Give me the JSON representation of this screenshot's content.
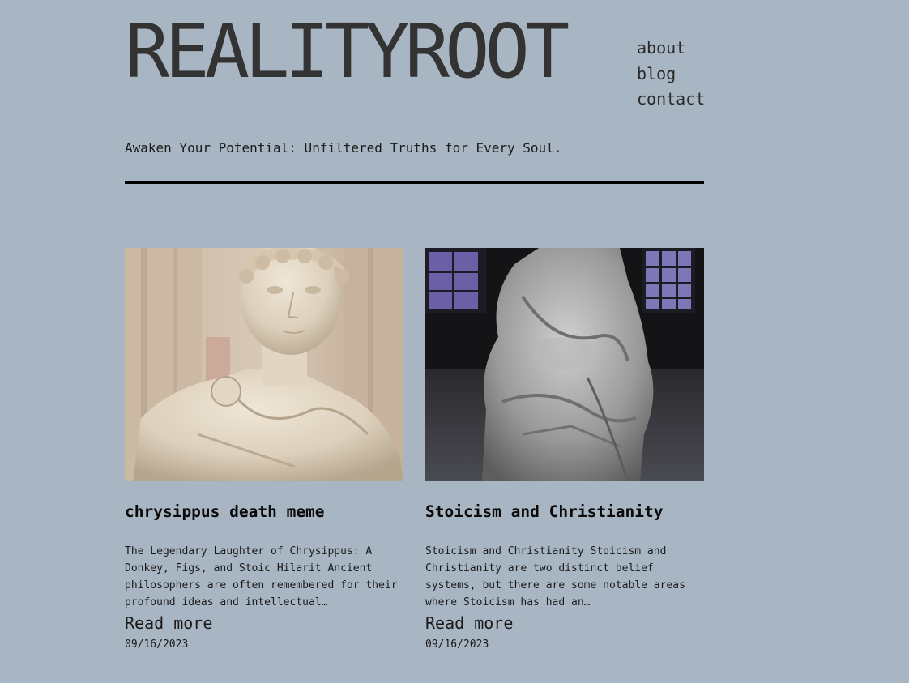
{
  "site": {
    "title": "REALITYROOT",
    "tagline": "Awaken Your Potential: Unfiltered Truths for Every Soul."
  },
  "nav": {
    "items": [
      {
        "label": "about"
      },
      {
        "label": "blog"
      },
      {
        "label": "contact"
      }
    ]
  },
  "posts": [
    {
      "image": "marble-bust-image",
      "title": "chrysippus death meme",
      "excerpt": "The Legendary Laughter of Chrysippus: A Donkey, Figs, and Stoic Hilarit Ancient philosophers are often remembered for their profound ideas and intellectual…",
      "read_more": "Read more",
      "date": "09/16/2023"
    },
    {
      "image": "seated-statue-image",
      "title": "Stoicism and Christianity",
      "excerpt": "Stoicism and Christianity Stoicism and Christianity are two distinct belief systems, but there are some notable areas where Stoicism has had an…",
      "read_more": "Read more",
      "date": "09/16/2023"
    }
  ],
  "colors": {
    "background": "#a8b5c2",
    "title": "#333333",
    "text": "#1a1a1a",
    "divider": "#000000"
  }
}
